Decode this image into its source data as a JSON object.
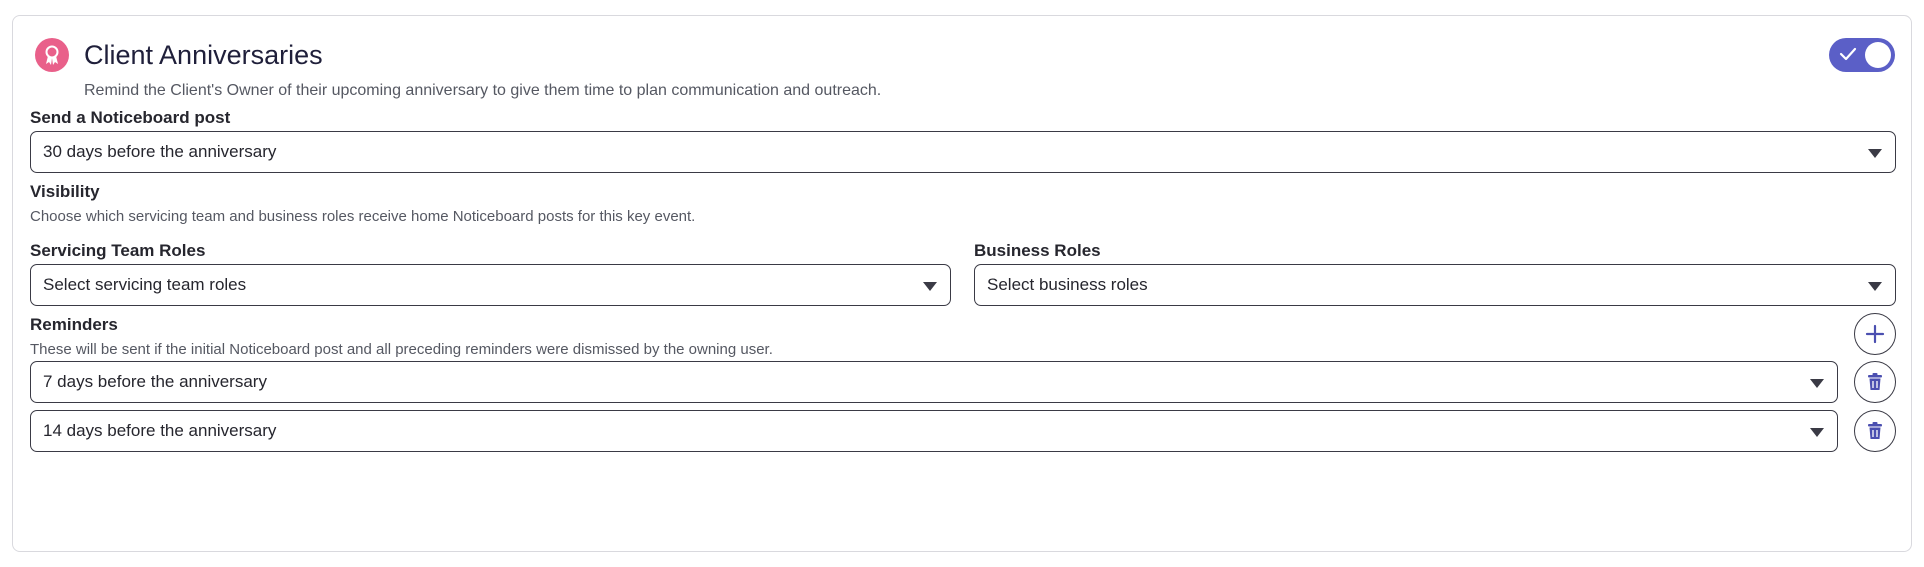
{
  "header": {
    "title": "Client Anniversaries",
    "subtitle": "Remind the Client's Owner of their upcoming anniversary to give them time to plan communication and outreach.",
    "icon": "award-ribbon-icon",
    "enabled": true
  },
  "noticeboard": {
    "label": "Send a Noticeboard post",
    "selected": "30 days before the anniversary"
  },
  "visibility": {
    "label": "Visibility",
    "help": "Choose which servicing team and business roles receive home Noticeboard posts for this key event.",
    "servicing_team": {
      "label": "Servicing Team Roles",
      "placeholder": "Select servicing team roles"
    },
    "business": {
      "label": "Business Roles",
      "placeholder": "Select business roles"
    }
  },
  "reminders": {
    "label": "Reminders",
    "help": "These will be sent if the initial Noticeboard post and all preceding reminders were dismissed by the owning user.",
    "items": [
      {
        "selected": "7 days before the anniversary"
      },
      {
        "selected": "14 days before the anniversary"
      }
    ]
  },
  "colors": {
    "accent": "#5b5fc7",
    "icon_pink": "#e9608a"
  }
}
